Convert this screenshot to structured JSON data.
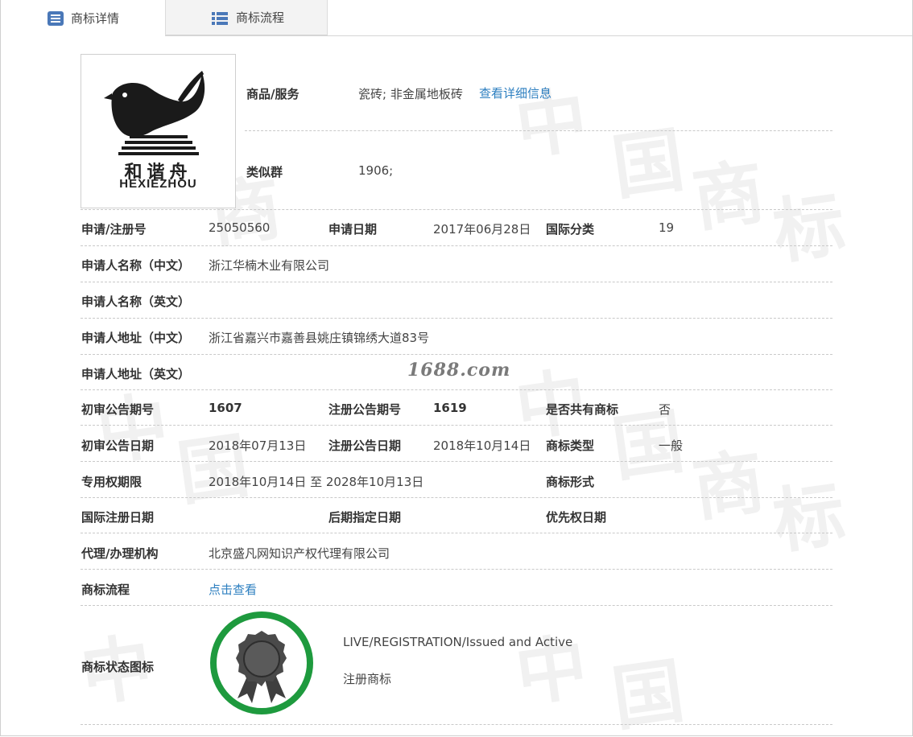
{
  "tabs": [
    {
      "label": "商标详情",
      "icon": "list-document-icon",
      "active": true
    },
    {
      "label": "商标流程",
      "icon": "list-icon",
      "active": false
    }
  ],
  "logo": {
    "chinese": "和谐舟",
    "english": "HEXIEZHOU"
  },
  "goods": {
    "label": "商品/服务",
    "value": "瓷砖; 非金属地板砖",
    "link": "查看详细信息"
  },
  "similar_group": {
    "label": "类似群",
    "value": "1906;"
  },
  "rows": {
    "reg_no": {
      "label": "申请/注册号",
      "value": "25050560"
    },
    "apply_date": {
      "label": "申请日期",
      "value": "2017年06月28日"
    },
    "intl_class": {
      "label": "国际分类",
      "value": "19"
    },
    "applicant_cn": {
      "label": "申请人名称（中文）",
      "value": "浙江华楠木业有限公司"
    },
    "applicant_en": {
      "label": "申请人名称（英文）",
      "value": ""
    },
    "address_cn": {
      "label": "申请人地址（中文）",
      "value": "浙江省嘉兴市嘉善县姚庄镇锦绣大道83号"
    },
    "address_en": {
      "label": "申请人地址（英文）",
      "value": ""
    },
    "prelim_no": {
      "label": "初审公告期号",
      "value": "1607"
    },
    "reg_notice_no": {
      "label": "注册公告期号",
      "value": "1619"
    },
    "shared": {
      "label": "是否共有商标",
      "value": "否"
    },
    "prelim_date": {
      "label": "初审公告日期",
      "value": "2018年07月13日"
    },
    "reg_notice_date": {
      "label": "注册公告日期",
      "value": "2018年10月14日"
    },
    "tm_type": {
      "label": "商标类型",
      "value": "一般"
    },
    "exclusive_period": {
      "label": "专用权期限",
      "value": "2018年10月14日 至 2028年10月13日"
    },
    "tm_form": {
      "label": "商标形式",
      "value": ""
    },
    "intl_reg_date": {
      "label": "国际注册日期",
      "value": ""
    },
    "later_designation": {
      "label": "后期指定日期",
      "value": ""
    },
    "priority_date": {
      "label": "优先权日期",
      "value": ""
    },
    "agency": {
      "label": "代理/办理机构",
      "value": "北京盛凡网知识产权代理有限公司"
    },
    "flow": {
      "label": "商标流程",
      "link": "点击查看"
    },
    "status_icon": {
      "label": "商标状态图标",
      "status_en": "LIVE/REGISTRATION/Issued and Active",
      "status_cn": "注册商标"
    }
  },
  "watermark_brand": "1688.com",
  "colors": {
    "link": "#2d7fc0",
    "status_ring": "#1e9a3e",
    "seal": "#4a4a4a"
  }
}
